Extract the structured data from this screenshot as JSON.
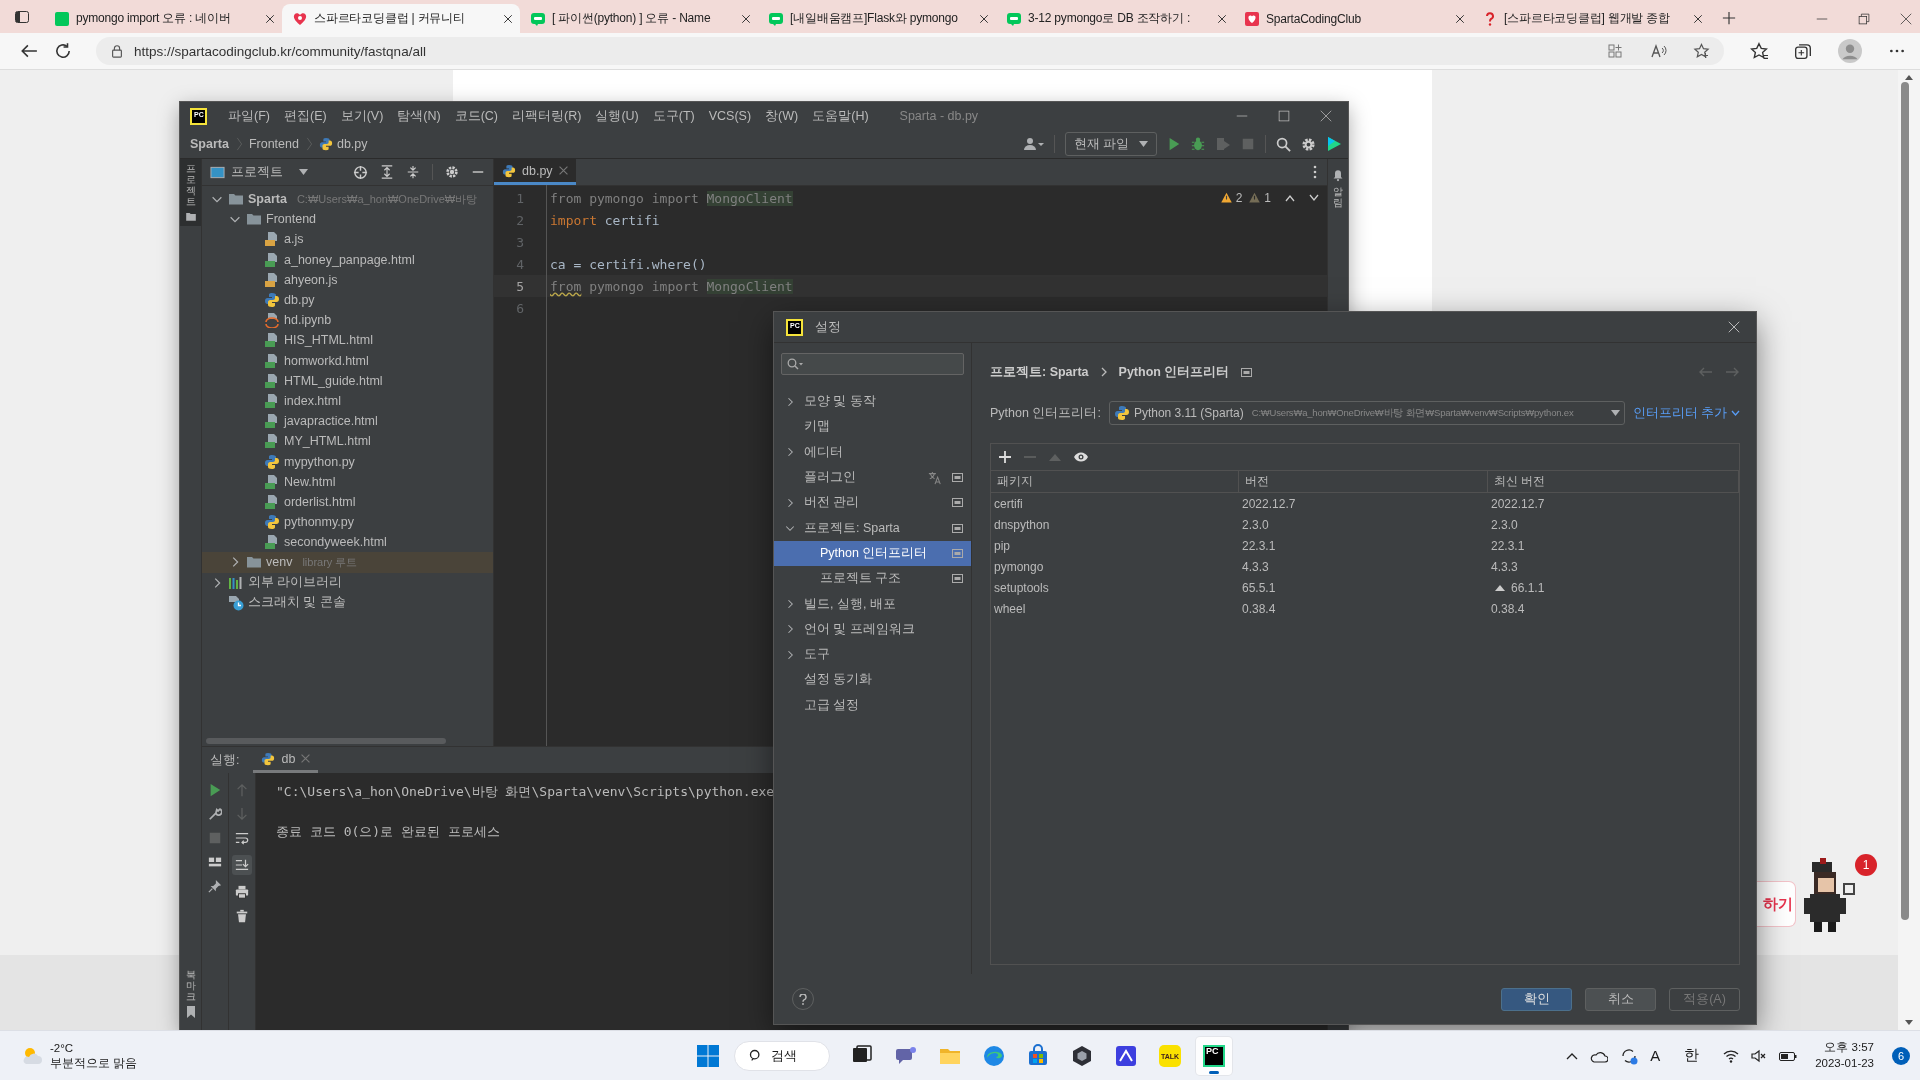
{
  "browser": {
    "tabs": [
      {
        "title": "pymongo import 오류 : 네이버",
        "kind": "naver",
        "selected": false
      },
      {
        "title": "스파르타코딩클럽 | 커뮤니티",
        "kind": "sparta",
        "selected": true
      },
      {
        "title": "[ 파이썬(python) ] 오류 - Name",
        "kind": "blog",
        "selected": false
      },
      {
        "title": "[내일배움캠프]Flask와 pymongo",
        "kind": "blog",
        "selected": false
      },
      {
        "title": "3-12 pymongo로 DB 조작하기 :",
        "kind": "blog",
        "selected": false
      },
      {
        "title": "SpartaCodingClub",
        "kind": "sparta-square",
        "selected": false
      },
      {
        "title": "[스파르타코딩클럽] 웹개발 종합",
        "kind": "question",
        "selected": false
      }
    ],
    "url": "https://spartacodingclub.kr/community/fastqna/all"
  },
  "page": {
    "cta_button": "하기",
    "notification_count": "1"
  },
  "ide": {
    "logo": "PC",
    "title": "Sparta - db.py",
    "menu": [
      "파일(F)",
      "편집(E)",
      "보기(V)",
      "탐색(N)",
      "코드(C)",
      "리팩터링(R)",
      "실행(U)",
      "도구(T)",
      "VCS(S)",
      "창(W)",
      "도움말(H)"
    ],
    "breadcrumb": [
      {
        "label": "Sparta",
        "kind": "project"
      },
      {
        "label": "Frontend",
        "kind": "folder"
      },
      {
        "label": "db.py",
        "kind": "py"
      }
    ],
    "run_config": "현재 파일",
    "left_stripe": {
      "top": "프로젝트",
      "bottom": "북마크"
    },
    "right_stripe": "알림",
    "project": {
      "title": "프로젝트",
      "tree": [
        {
          "name": "Sparta",
          "hint": "C:₩Users₩a_hon₩OneDrive₩바탕",
          "kind": "folder",
          "bold": true,
          "expanded": true,
          "selected": false,
          "children": [
            {
              "name": "Frontend",
              "kind": "folder",
              "expanded": true,
              "selected": false,
              "children": [
                {
                  "name": "a.js",
                  "kind": "js",
                  "selected": false
                },
                {
                  "name": "a_honey_panpage.html",
                  "kind": "html",
                  "selected": false
                },
                {
                  "name": "ahyeon.js",
                  "kind": "js",
                  "selected": false
                },
                {
                  "name": "db.py",
                  "kind": "py",
                  "selected": false
                },
                {
                  "name": "hd.ipynb",
                  "kind": "ipynb",
                  "selected": false
                },
                {
                  "name": "HIS_HTML.html",
                  "kind": "html",
                  "selected": false
                },
                {
                  "name": "homworkd.html",
                  "kind": "html",
                  "selected": false
                },
                {
                  "name": "HTML_guide.html",
                  "kind": "html",
                  "selected": false
                },
                {
                  "name": "index.html",
                  "kind": "html",
                  "selected": false
                },
                {
                  "name": "javapractice.html",
                  "kind": "html",
                  "selected": false
                },
                {
                  "name": "MY_HTML.html",
                  "kind": "html",
                  "selected": false
                },
                {
                  "name": "mypython.py",
                  "kind": "py",
                  "selected": false
                },
                {
                  "name": "New.html",
                  "kind": "html",
                  "selected": false
                },
                {
                  "name": "orderlist.html",
                  "kind": "html",
                  "selected": false
                },
                {
                  "name": "pythonmy.py",
                  "kind": "py",
                  "selected": false
                },
                {
                  "name": "secondyweek.html",
                  "kind": "html",
                  "selected": false
                }
              ]
            },
            {
              "name": "venv",
              "hint": "library 루트",
              "kind": "folder",
              "expanded": false,
              "selected": true
            }
          ]
        },
        {
          "name": "외부 라이브러리",
          "kind": "libraries",
          "expanded": false,
          "selected": false
        },
        {
          "name": "스크래치 및 콘솔",
          "kind": "scratch",
          "selected": false
        }
      ]
    },
    "editor": {
      "tab": "db.py",
      "warnings": "2",
      "weak_warnings": "1",
      "lines": [
        {
          "number": "1",
          "current": false,
          "segments": [
            {
              "text": "from pymongo import ",
              "kind": "unused"
            },
            {
              "text": "MongoClient",
              "kind": "match"
            }
          ]
        },
        {
          "number": "2",
          "current": false,
          "segments": [
            {
              "text": "import",
              "kind": "keyword"
            },
            {
              "text": " certifi",
              "kind": "plain"
            }
          ]
        },
        {
          "number": "3",
          "current": false
        },
        {
          "number": "4",
          "current": false,
          "segments": [
            {
              "text": "ca = certifi.where()",
              "kind": "plain"
            }
          ]
        },
        {
          "number": "5",
          "current": true,
          "segments": [
            {
              "text": "from",
              "kind": "warn"
            },
            {
              "text": " pymongo import ",
              "kind": "unused"
            },
            {
              "text": "MongoClient",
              "kind": "match"
            }
          ]
        },
        {
          "number": "6",
          "current": false
        }
      ]
    },
    "run": {
      "label": "실행:",
      "tab": "db",
      "output": [
        "\"C:\\Users\\a_hon\\OneDrive\\바탕 화면\\Sparta\\venv\\Scripts\\python.exe",
        "종료 코드 0(으)로 완료된 프로세스"
      ]
    }
  },
  "settings": {
    "logo": "PC",
    "title": "설정",
    "nav": [
      {
        "label": "모양 및 동작",
        "expanded": false,
        "selected": false,
        "project_scope": false,
        "translate": false
      },
      {
        "label": "키맵",
        "selected": false,
        "project_scope": false,
        "translate": false
      },
      {
        "label": "에디터",
        "expanded": false,
        "selected": false,
        "project_scope": false,
        "translate": false
      },
      {
        "label": "플러그인",
        "selected": false,
        "project_scope": true,
        "translate": true
      },
      {
        "label": "버전 관리",
        "expanded": false,
        "selected": false,
        "project_scope": true,
        "translate": false
      },
      {
        "label": "프로젝트: Sparta",
        "expanded": true,
        "selected": false,
        "project_scope": true,
        "translate": false,
        "children": [
          {
            "label": "Python 인터프리터",
            "selected": true,
            "project_scope": true,
            "translate": false
          },
          {
            "label": "프로젝트 구조",
            "selected": false,
            "project_scope": true,
            "translate": false
          }
        ]
      },
      {
        "label": "빌드, 실행, 배포",
        "expanded": false,
        "selected": false,
        "project_scope": false,
        "translate": false
      },
      {
        "label": "언어 및 프레임워크",
        "expanded": false,
        "selected": false,
        "project_scope": false,
        "translate": false
      },
      {
        "label": "도구",
        "expanded": false,
        "selected": false,
        "project_scope": false,
        "translate": false
      },
      {
        "label": "설정 동기화",
        "selected": false,
        "project_scope": false,
        "translate": false
      },
      {
        "label": "고급 설정",
        "selected": false,
        "project_scope": false,
        "translate": false
      }
    ],
    "breadcrumb": [
      "프로젝트: Sparta",
      "Python 인터프리터"
    ],
    "interpreter_label": "Python 인터프리터:",
    "interpreter": "Python 3.11 (Sparta)",
    "interpreter_path": "C:₩Users₩a_hon₩OneDrive₩바탕 화면₩Sparta₩venv₩Scripts₩python.ex",
    "add_interpreter": "인터프리터 추가",
    "columns": [
      "패키지",
      "버전",
      "최신 버전"
    ],
    "packages": [
      {
        "name": "certifi",
        "version": "2022.12.7",
        "latest": "2022.12.7",
        "upgrade": false
      },
      {
        "name": "dnspython",
        "version": "2.3.0",
        "latest": "2.3.0",
        "upgrade": false
      },
      {
        "name": "pip",
        "version": "22.3.1",
        "latest": "22.3.1",
        "upgrade": false
      },
      {
        "name": "pymongo",
        "version": "4.3.3",
        "latest": "4.3.3",
        "upgrade": false
      },
      {
        "name": "setuptools",
        "version": "65.5.1",
        "latest": "66.1.1",
        "upgrade": true
      },
      {
        "name": "wheel",
        "version": "0.38.4",
        "latest": "0.38.4",
        "upgrade": false
      }
    ],
    "buttons": [
      {
        "label": "확인",
        "kind": "primary",
        "disabled": false
      },
      {
        "label": "취소",
        "kind": "normal",
        "disabled": false
      },
      {
        "label": "적용(A)",
        "kind": "normal",
        "disabled": true
      }
    ]
  },
  "taskbar": {
    "weather": {
      "temp": "-2°C",
      "text": "부분적으로 맑음"
    },
    "search": "검색",
    "apps": [
      {
        "kind": "task-view",
        "active": false
      },
      {
        "kind": "chat",
        "active": false
      },
      {
        "kind": "explorer",
        "active": false
      },
      {
        "kind": "edge",
        "active": false
      },
      {
        "kind": "store",
        "active": false
      },
      {
        "kind": "unity",
        "active": false
      },
      {
        "kind": "teams-app",
        "active": false
      },
      {
        "kind": "kakaotalk",
        "label": "TALK",
        "active": false
      },
      {
        "kind": "pycharm",
        "label": "PC",
        "active": true
      }
    ],
    "ime_mode": "A",
    "ime_lang": "한",
    "time": "오후 3:57",
    "date": "2023-01-23",
    "notifications": "6"
  }
}
